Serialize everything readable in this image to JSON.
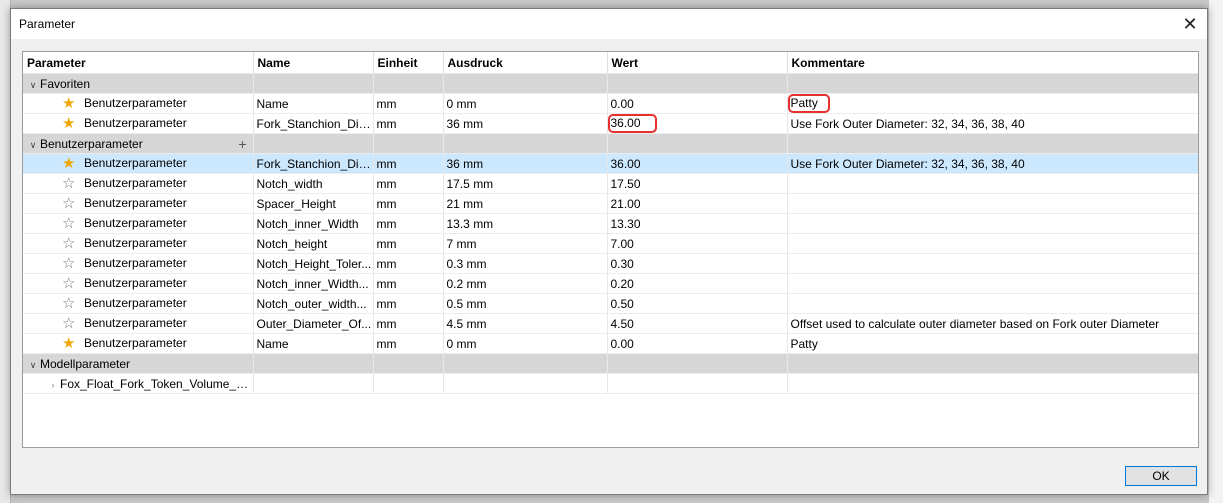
{
  "window": {
    "title": "Parameter",
    "close_glyph": "✕"
  },
  "columns": [
    "Parameter",
    "Name",
    "Einheit",
    "Ausdruck",
    "Wert",
    "Kommentare"
  ],
  "groups": {
    "favorites": {
      "label": "Favoriten",
      "rows": [
        {
          "type": "Benutzerparameter",
          "name": "Name",
          "unit": "mm",
          "expr": "0 mm",
          "value": "0.00",
          "comment": "Patty",
          "favorite": true
        },
        {
          "type": "Benutzerparameter",
          "name": "Fork_Stanchion_Dia...",
          "unit": "mm",
          "expr": "36 mm",
          "value": "36.00",
          "comment": "Use Fork Outer Diameter: 32, 34, 36, 38, 40",
          "favorite": true
        }
      ]
    },
    "user": {
      "label": "Benutzerparameter",
      "rows": [
        {
          "type": "Benutzerparameter",
          "name": "Fork_Stanchion_Dia...",
          "unit": "mm",
          "expr": "36 mm",
          "value": "36.00",
          "comment": "Use Fork Outer Diameter: 32, 34, 36, 38, 40",
          "favorite": true
        },
        {
          "type": "Benutzerparameter",
          "name": "Notch_width",
          "unit": "mm",
          "expr": "17.5 mm",
          "value": "17.50",
          "comment": "",
          "favorite": false
        },
        {
          "type": "Benutzerparameter",
          "name": "Spacer_Height",
          "unit": "mm",
          "expr": "21 mm",
          "value": "21.00",
          "comment": "",
          "favorite": false
        },
        {
          "type": "Benutzerparameter",
          "name": "Notch_inner_Width",
          "unit": "mm",
          "expr": "13.3 mm",
          "value": "13.30",
          "comment": "",
          "favorite": false
        },
        {
          "type": "Benutzerparameter",
          "name": "Notch_height",
          "unit": "mm",
          "expr": "7 mm",
          "value": "7.00",
          "comment": "",
          "favorite": false
        },
        {
          "type": "Benutzerparameter",
          "name": "Notch_Height_Toler...",
          "unit": "mm",
          "expr": "0.3 mm",
          "value": "0.30",
          "comment": "",
          "favorite": false
        },
        {
          "type": "Benutzerparameter",
          "name": "Notch_inner_Width...",
          "unit": "mm",
          "expr": "0.2 mm",
          "value": "0.20",
          "comment": "",
          "favorite": false
        },
        {
          "type": "Benutzerparameter",
          "name": "Notch_outer_width...",
          "unit": "mm",
          "expr": "0.5 mm",
          "value": "0.50",
          "comment": "",
          "favorite": false
        },
        {
          "type": "Benutzerparameter",
          "name": "Outer_Diameter_Of...",
          "unit": "mm",
          "expr": "4.5 mm",
          "value": "4.50",
          "comment": "Offset used to calculate outer diameter based on Fork outer Diameter",
          "favorite": false
        },
        {
          "type": "Benutzerparameter",
          "name": "Name",
          "unit": "mm",
          "expr": "0 mm",
          "value": "0.00",
          "comment": "Patty",
          "favorite": true
        }
      ]
    },
    "model": {
      "label": "Modellparameter",
      "child": "Fox_Float_Fork_Token_Volume_Sp..."
    }
  },
  "buttons": {
    "ok": "OK"
  }
}
